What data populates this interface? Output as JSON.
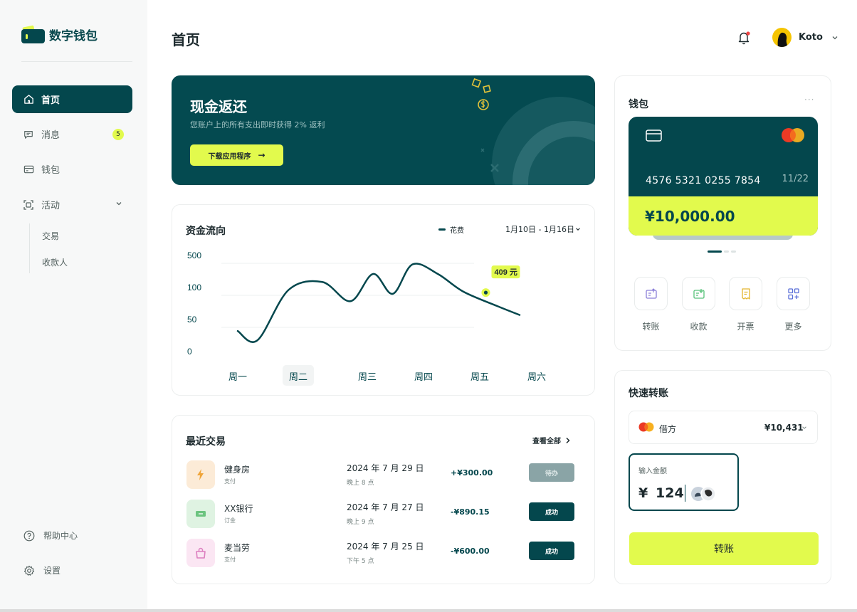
{
  "app": {
    "name": "数字钱包"
  },
  "sidebar": {
    "items": [
      {
        "label": "首页"
      },
      {
        "label": "消息",
        "badge": "5"
      },
      {
        "label": "钱包"
      },
      {
        "label": "活动"
      }
    ],
    "sub_items": [
      {
        "label": "交易"
      },
      {
        "label": "收款人"
      }
    ],
    "bottom": [
      {
        "label": "帮助中心"
      },
      {
        "label": "设置"
      }
    ]
  },
  "header": {
    "title": "首页",
    "user_name": "Koto"
  },
  "promo": {
    "title": "现金返还",
    "subtitle": "您账户上的所有支出即时获得 2% 返利",
    "button": "下载应用程序",
    "arrow": "→"
  },
  "cashflow": {
    "title": "资金流向",
    "legend": "花费",
    "date_range": "1月10日 - 1月16日",
    "tooltip": "409 元"
  },
  "chart_data": {
    "type": "line",
    "title": "资金流向",
    "categories": [
      "周一",
      "周二",
      "周三",
      "周四",
      "周五",
      "周六"
    ],
    "selected_category": "周二",
    "y_ticks": [
      "500",
      "100",
      "50",
      "0"
    ],
    "series": [
      {
        "name": "花费",
        "points": [
          [
            0,
            0.62
          ],
          [
            0.35,
            0.33
          ],
          [
            0.9,
            1.9
          ],
          [
            1.5,
            2.15
          ],
          [
            2.0,
            1.55
          ],
          [
            2.4,
            2.4
          ],
          [
            2.75,
            1.78
          ],
          [
            3.1,
            2.7
          ],
          [
            3.55,
            2.4
          ],
          [
            4.0,
            1.85
          ],
          [
            4.6,
            1.4
          ],
          [
            5.0,
            1.12
          ]
        ]
      }
    ],
    "highlight": {
      "x": 4.4,
      "label": "409 元"
    }
  },
  "transactions": {
    "title": "最近交易",
    "view_all": "查看全部",
    "rows": [
      {
        "name": "健身房",
        "type": "支付",
        "date": "2024 年 7 月 29 日",
        "time": "晚上 8 点",
        "amount": "+¥300.00",
        "status": "待办",
        "icon": "lightning-icon",
        "icon_bg": "#fcebd7",
        "icon_color": "#f0a53a",
        "state": "pending"
      },
      {
        "name": "XX银行",
        "type": "订金",
        "date": "2024 年 7 月 27 日",
        "time": "晚上 9 点",
        "amount": "-¥890.15",
        "status": "成功",
        "icon": "ticket-icon",
        "icon_bg": "#dff3e2",
        "icon_color": "#6cc47f",
        "state": "success"
      },
      {
        "name": "麦当劳",
        "type": "支付",
        "date": "2024 年 7 月 25 日",
        "time": "下午 5 点",
        "amount": "-¥600.00",
        "status": "成功",
        "icon": "shopping-bag-icon",
        "icon_bg": "#fbe6f3",
        "icon_color": "#dd7fc0",
        "state": "success"
      }
    ]
  },
  "wallet": {
    "title": "钱包",
    "more": "···",
    "card_number": "4576 5321 0255 7854",
    "expiry": "11/22",
    "balance": "¥10,000.00",
    "actions": [
      {
        "label": "转账",
        "icon": "transfer-icon"
      },
      {
        "label": "收款",
        "icon": "receive-icon"
      },
      {
        "label": "开票",
        "icon": "invoice-icon"
      },
      {
        "label": "更多",
        "icon": "more-grid-icon"
      }
    ]
  },
  "quick_transfer": {
    "title": "快速转账",
    "account_type": "借方",
    "account_balance": "¥10,431",
    "amount_label": "输入金额",
    "currency": "¥",
    "amount": "124",
    "button": "转账"
  },
  "colors": {
    "primary": "#04474d",
    "accent": "#e2fa4d"
  }
}
